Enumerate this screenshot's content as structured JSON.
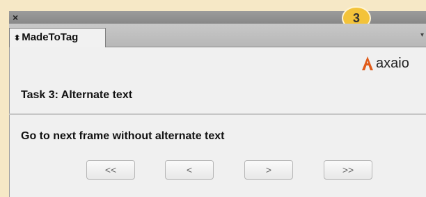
{
  "window": {
    "close_label": "×"
  },
  "overlay": {
    "step_number": "3"
  },
  "tabs": [
    {
      "label": "MadeToTag"
    }
  ],
  "logo": {
    "text": "axaio",
    "brand_color": "#e05b1a"
  },
  "task": {
    "title": "Task 3: Alternate text",
    "instruction": "Go to next frame without alternate text"
  },
  "nav": {
    "first_label": "<<",
    "prev_label": "<",
    "next_label": ">",
    "last_label": ">>"
  },
  "icons": {
    "tab_sort": "up-down-chevron-icon",
    "panel_menu": "chevron-down-icon",
    "logo_mark": "axaio-logo-icon"
  }
}
